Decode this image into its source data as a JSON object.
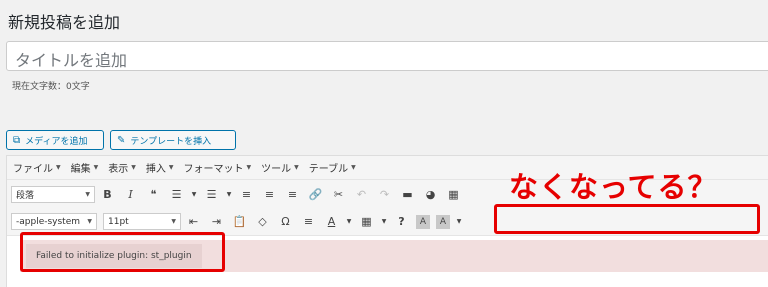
{
  "page": {
    "title": "新規投稿を追加"
  },
  "title_field": {
    "placeholder": "タイトルを追加"
  },
  "char_count": "現在文字数：0文字",
  "buttons": {
    "add_media": "メディアを追加",
    "insert_template": "テンプレートを挿入"
  },
  "menubar": [
    "ファイル",
    "編集",
    "表示",
    "挿入",
    "フォーマット",
    "ツール",
    "テーブル"
  ],
  "toolbar1": {
    "format_select": "段落",
    "bold": "B",
    "italic": "I",
    "blockquote": "❝",
    "bullet_list": "☰",
    "numbered_list": "☰",
    "align_left": "≡",
    "align_center": "≡",
    "align_right": "≡",
    "link": "🔗",
    "unlink": "✂",
    "undo": "↶",
    "redo": "↷",
    "hr": "▬",
    "pie": "◕",
    "toggle": "▦"
  },
  "toolbar2": {
    "font_select": "-apple-system",
    "size_select": "11pt",
    "outdent": "⇤",
    "indent": "⇥",
    "paste": "📋",
    "clear": "◇",
    "omega": "Ω",
    "hr2": "≡",
    "text_color": "A",
    "table": "▦",
    "help": "?",
    "bg_a": "A",
    "bg_b": "A"
  },
  "error": {
    "message": "Failed to initialize plugin: st_plugin"
  },
  "annotation": {
    "text": "なくなってる？",
    "color": "#e60000"
  }
}
